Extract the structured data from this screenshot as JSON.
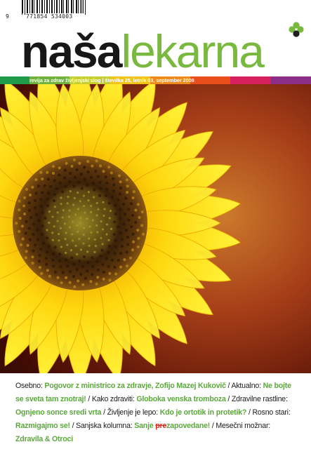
{
  "barcode": {
    "lead_digit": "9",
    "digits": "771854 534003"
  },
  "masthead": {
    "part1": "naša",
    "part2": "lekarna"
  },
  "colors": {
    "brand_green": "#7ab940",
    "highlight_green": "#5aa83a",
    "strike_red": "#d12b1e",
    "strip": [
      "#1f9a48",
      "#6fb23d",
      "#c6cf2d",
      "#f2c418",
      "#f08a1c",
      "#e94e1b",
      "#d6205d",
      "#8a2e8a"
    ]
  },
  "strip": {
    "text": "revija za zdrav življenjski slog | številka 25, letnik 03, september 2008"
  },
  "footer": {
    "s1_label": "Osebno: ",
    "s1_title": "Pogovor z ministrico za zdravje, Zofijo Mazej Kukovič",
    "s2_label": " / Aktualno: ",
    "s2_title": "Ne bojte se sveta tam znotraj!",
    "s3_label": " / Kako zdraviti: ",
    "s3_title": "Globoka venska tromboza",
    "s4_label": " / Zdravilne rastline: ",
    "s4_title": "Ognjeno sonce sredi vrta",
    "s5_label": " / Življenje je lepo: ",
    "s5_title": "Kdo je ortotik in protetik?",
    "s6_label": " / Rosno stari: ",
    "s6_title": "Razmigajmo se!",
    "s7_label": " / Sanjska kolumna: ",
    "s7_title_a": "Sanje ",
    "s7_strike": "pre",
    "s7_title_b": "zapovedane!",
    "s8_label": " / Mesečni možnar: ",
    "s8_title": "Zdravila & Otroci"
  }
}
